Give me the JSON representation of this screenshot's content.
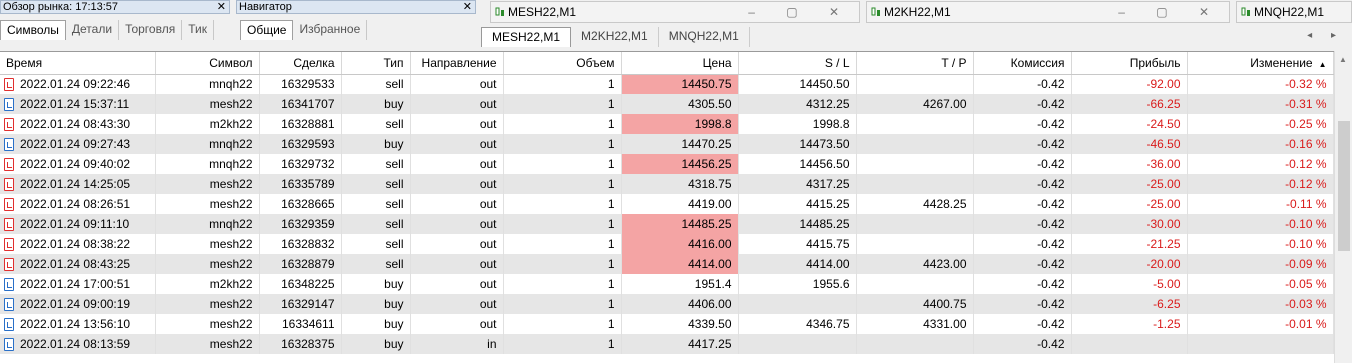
{
  "market_watch": {
    "title": "Обзор рынка: 17:13:57",
    "tabs": [
      "Символы",
      "Детали",
      "Торговля",
      "Тик"
    ]
  },
  "navigator": {
    "title": "Навигатор",
    "tabs": [
      "Общие",
      "Избранное"
    ]
  },
  "chart_windows": [
    {
      "title": "MESH22,M1"
    },
    {
      "title": "M2KH22,M1"
    },
    {
      "title": "MNQH22,M1"
    }
  ],
  "chart_tabs": [
    "MESH22,M1",
    "M2KH22,M1",
    "MNQH22,M1"
  ],
  "columns": [
    "Время",
    "Символ",
    "Сделка",
    "Тип",
    "Направление",
    "Объем",
    "Цена",
    "S / L",
    "T / P",
    "Комиссия",
    "Прибыль",
    "Изменение"
  ],
  "rows": [
    {
      "time": "2022.01.24 09:22:46",
      "symbol": "mnqh22",
      "deal": "16329533",
      "type": "sell",
      "direction": "out",
      "volume": "1",
      "price": "14450.75",
      "sl": "14450.50",
      "tp": "",
      "commission": "-0.42",
      "profit": "-92.00",
      "change": "-0.32 %",
      "hl": true
    },
    {
      "time": "2022.01.24 15:37:11",
      "symbol": "mesh22",
      "deal": "16341707",
      "type": "buy",
      "direction": "out",
      "volume": "1",
      "price": "4305.50",
      "sl": "4312.25",
      "tp": "4267.00",
      "commission": "-0.42",
      "profit": "-66.25",
      "change": "-0.31 %",
      "hl": false
    },
    {
      "time": "2022.01.24 08:43:30",
      "symbol": "m2kh22",
      "deal": "16328881",
      "type": "sell",
      "direction": "out",
      "volume": "1",
      "price": "1998.8",
      "sl": "1998.8",
      "tp": "",
      "commission": "-0.42",
      "profit": "-24.50",
      "change": "-0.25 %",
      "hl": true
    },
    {
      "time": "2022.01.24 09:27:43",
      "symbol": "mnqh22",
      "deal": "16329593",
      "type": "buy",
      "direction": "out",
      "volume": "1",
      "price": "14470.25",
      "sl": "14473.50",
      "tp": "",
      "commission": "-0.42",
      "profit": "-46.50",
      "change": "-0.16 %",
      "hl": false
    },
    {
      "time": "2022.01.24 09:40:02",
      "symbol": "mnqh22",
      "deal": "16329732",
      "type": "sell",
      "direction": "out",
      "volume": "1",
      "price": "14456.25",
      "sl": "14456.50",
      "tp": "",
      "commission": "-0.42",
      "profit": "-36.00",
      "change": "-0.12 %",
      "hl": true
    },
    {
      "time": "2022.01.24 14:25:05",
      "symbol": "mesh22",
      "deal": "16335789",
      "type": "sell",
      "direction": "out",
      "volume": "1",
      "price": "4318.75",
      "sl": "4317.25",
      "tp": "",
      "commission": "-0.42",
      "profit": "-25.00",
      "change": "-0.12 %",
      "hl": false
    },
    {
      "time": "2022.01.24 08:26:51",
      "symbol": "mesh22",
      "deal": "16328665",
      "type": "sell",
      "direction": "out",
      "volume": "1",
      "price": "4419.00",
      "sl": "4415.25",
      "tp": "4428.25",
      "commission": "-0.42",
      "profit": "-25.00",
      "change": "-0.11 %",
      "hl": false
    },
    {
      "time": "2022.01.24 09:11:10",
      "symbol": "mnqh22",
      "deal": "16329359",
      "type": "sell",
      "direction": "out",
      "volume": "1",
      "price": "14485.25",
      "sl": "14485.25",
      "tp": "",
      "commission": "-0.42",
      "profit": "-30.00",
      "change": "-0.10 %",
      "hl": true
    },
    {
      "time": "2022.01.24 08:38:22",
      "symbol": "mesh22",
      "deal": "16328832",
      "type": "sell",
      "direction": "out",
      "volume": "1",
      "price": "4416.00",
      "sl": "4415.75",
      "tp": "",
      "commission": "-0.42",
      "profit": "-21.25",
      "change": "-0.10 %",
      "hl": true
    },
    {
      "time": "2022.01.24 08:43:25",
      "symbol": "mesh22",
      "deal": "16328879",
      "type": "sell",
      "direction": "out",
      "volume": "1",
      "price": "4414.00",
      "sl": "4414.00",
      "tp": "4423.00",
      "commission": "-0.42",
      "profit": "-20.00",
      "change": "-0.09 %",
      "hl": true
    },
    {
      "time": "2022.01.24 17:00:51",
      "symbol": "m2kh22",
      "deal": "16348225",
      "type": "buy",
      "direction": "out",
      "volume": "1",
      "price": "1951.4",
      "sl": "1955.6",
      "tp": "",
      "commission": "-0.42",
      "profit": "-5.00",
      "change": "-0.05 %",
      "hl": false
    },
    {
      "time": "2022.01.24 09:00:19",
      "symbol": "mesh22",
      "deal": "16329147",
      "type": "buy",
      "direction": "out",
      "volume": "1",
      "price": "4406.00",
      "sl": "",
      "tp": "4400.75",
      "commission": "-0.42",
      "profit": "-6.25",
      "change": "-0.03 %",
      "hl": false
    },
    {
      "time": "2022.01.24 13:56:10",
      "symbol": "mesh22",
      "deal": "16334611",
      "type": "buy",
      "direction": "out",
      "volume": "1",
      "price": "4339.50",
      "sl": "4346.75",
      "tp": "4331.00",
      "commission": "-0.42",
      "profit": "-1.25",
      "change": "-0.01 %",
      "hl": false
    },
    {
      "time": "2022.01.24 08:13:59",
      "symbol": "mesh22",
      "deal": "16328375",
      "type": "buy",
      "direction": "in",
      "volume": "1",
      "price": "4417.25",
      "sl": "",
      "tp": "",
      "commission": "-0.42",
      "profit": "",
      "change": "",
      "hl": false
    }
  ],
  "colors": {
    "price_highlight": "#f4a4a4",
    "negative": "#d91a1a",
    "sell_icon": "#e03030",
    "buy_icon": "#2a70c8",
    "alt_row": "#e6e6e6"
  }
}
